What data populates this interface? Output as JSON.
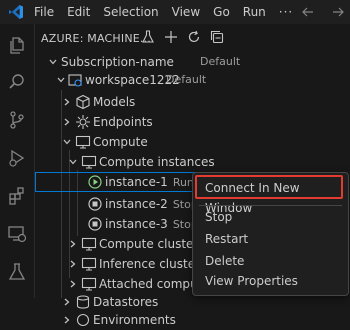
{
  "menu": {
    "items": [
      "File",
      "Edit",
      "Selection",
      "View",
      "Go",
      "Run"
    ],
    "more": "···"
  },
  "sidebar": {
    "title": "AZURE: MACHINE...",
    "tree": {
      "subscription": {
        "label": "Subscription-name",
        "desc": "Default"
      },
      "workspace": {
        "label": "workspace1222",
        "desc": "Default"
      },
      "models": "Models",
      "endpoints": "Endpoints",
      "compute": "Compute",
      "compute_instances": "Compute instances",
      "instances": [
        {
          "label": "instance-1",
          "status": "Running"
        },
        {
          "label": "instance-2",
          "status": "Stopp"
        },
        {
          "label": "instance-3",
          "status": "Stopp"
        }
      ],
      "compute_clusters": "Compute clusters",
      "inference_clusters": "Inference clusters",
      "attached_compute": "Attached compute",
      "datastores": "Datastores",
      "environments": "Environments"
    }
  },
  "context_menu": {
    "items": [
      "Connect In New Window",
      "Stop",
      "Restart",
      "Delete",
      "View Properties"
    ]
  },
  "colors": {
    "accent": "#0078d4",
    "highlight": "#e03c31",
    "running": "#89d185",
    "vscode_blue": "#2f8fe0"
  },
  "icons": {
    "activity": [
      "explorer-icon",
      "search-icon",
      "source-control-icon",
      "run-debug-icon",
      "extensions-icon",
      "remote-explorer-icon",
      "testing-icon"
    ]
  }
}
